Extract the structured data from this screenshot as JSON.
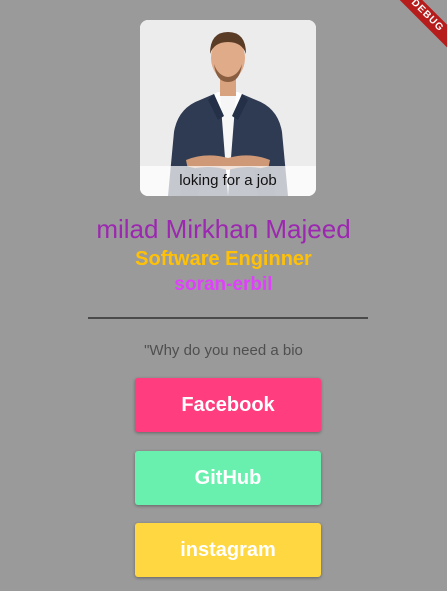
{
  "debug_banner": "DEBUG",
  "profile": {
    "image_caption": "loking for a job",
    "name": "milad Mirkhan Majeed",
    "title": "Software Enginner",
    "location": "soran-erbil",
    "bio": "\"Why do you need a bio"
  },
  "buttons": {
    "facebook": "Facebook",
    "github": "GitHub",
    "instagram": "instagram"
  },
  "colors": {
    "background": "#9a9a9a",
    "name": "#9c27b0",
    "title": "#ffc107",
    "location": "#e040fb",
    "facebook": "#ff3d7f",
    "github": "#69f0ae",
    "instagram": "#ffd740"
  }
}
